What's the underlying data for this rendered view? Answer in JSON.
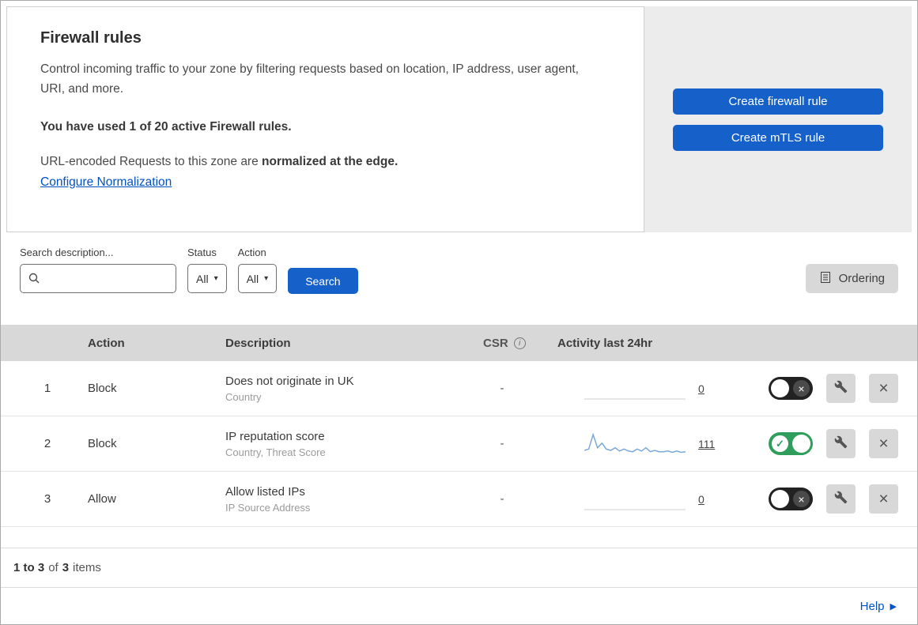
{
  "colors": {
    "primary_button": "#1561c9",
    "link": "#0051c3",
    "toggle_on": "#2f9e5c",
    "toggle_off": "#222222",
    "sparkline": "#7aa9d8",
    "sparkline_flat": "#cfcfcf",
    "table_header_bg": "#d8d8d8",
    "side_panel_bg": "#ececec"
  },
  "header": {
    "title": "Firewall rules",
    "description": "Control incoming traffic to your zone by filtering requests based on location, IP address, user agent, URI, and more.",
    "usage_bold": "You have used 1 of 20 active Firewall rules.",
    "normalization_prefix": "URL-encoded Requests to this zone are ",
    "normalization_bold": "normalized at the edge.",
    "link_label": "Configure Normalization",
    "buttons": {
      "create_firewall": "Create firewall rule",
      "create_mtls": "Create mTLS rule"
    }
  },
  "filters": {
    "search_label": "Search description...",
    "search_value": "",
    "status_label": "Status",
    "status_value": "All",
    "action_label": "Action",
    "action_value": "All",
    "search_button": "Search",
    "ordering_button": "Ordering"
  },
  "icons": {
    "info": "i",
    "caret_down": "▾",
    "check": "✓",
    "x_mark": "×",
    "help_arrow": "▶"
  },
  "table": {
    "headers": {
      "action": "Action",
      "description": "Description",
      "csr": "CSR",
      "activity": "Activity last 24hr"
    },
    "rows": [
      {
        "num": "1",
        "action": "Block",
        "description": "Does not originate in UK",
        "criteria": "Country",
        "csr": "-",
        "activity_count": "0",
        "enabled": false,
        "sparkline": []
      },
      {
        "num": "2",
        "action": "Block",
        "description": "IP reputation score",
        "criteria": "Country, Threat Score",
        "csr": "-",
        "activity_count": "111",
        "enabled": true,
        "sparkline": [
          6,
          8,
          30,
          10,
          17,
          8,
          6,
          10,
          5,
          8,
          5,
          4,
          8,
          5,
          10,
          4,
          6,
          4,
          4,
          5,
          3,
          5,
          3,
          4
        ]
      },
      {
        "num": "3",
        "action": "Allow",
        "description": "Allow listed IPs",
        "criteria": "IP Source Address",
        "csr": "-",
        "activity_count": "0",
        "enabled": false,
        "sparkline": []
      }
    ],
    "footer": {
      "range": "1 to 3",
      "of_text": "of",
      "total": "3",
      "items_text": "items"
    }
  },
  "help": {
    "label": "Help"
  }
}
